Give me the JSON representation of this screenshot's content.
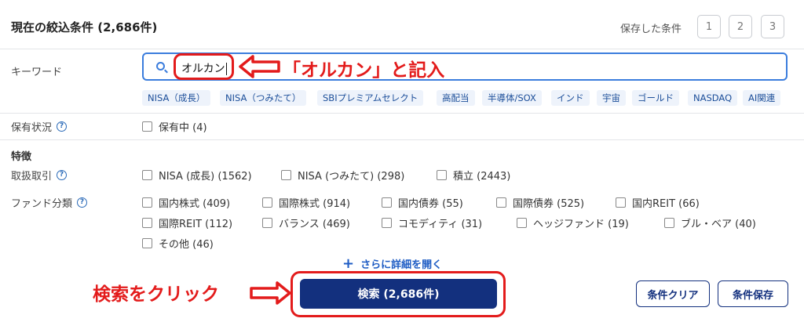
{
  "header": {
    "title": "現在の絞込条件 (2,686件)",
    "saved_label": "保存した条件",
    "slots": [
      "1",
      "2",
      "3"
    ]
  },
  "keyword": {
    "label": "キーワード",
    "value": "オルカン",
    "icon": "search-icon",
    "chips": [
      "NISA（成長）",
      "NISA（つみたて）",
      "SBIプレミアムセレクト",
      "高配当",
      "半導体/SOX",
      "インド",
      "宇宙",
      "ゴールド",
      "NASDAQ",
      "AI関連"
    ]
  },
  "holding": {
    "label": "保有状況",
    "options": [
      "保有中 (4)"
    ]
  },
  "features": {
    "section_label": "特徴",
    "handling": {
      "label": "取扱取引",
      "options": [
        "NISA (成長) (1562)",
        "NISA (つみたて) (298)",
        "積立 (2443)"
      ]
    },
    "category": {
      "label": "ファンド分類",
      "options": [
        "国内株式 (409)",
        "国際株式 (914)",
        "国内債券 (55)",
        "国際債券 (525)",
        "国内REIT (66)",
        "国際REIT (112)",
        "バランス (469)",
        "コモディティ (31)",
        "ヘッジファンド (19)",
        "ブル・ベア (40)",
        "その他 (46)"
      ]
    }
  },
  "more_link": "さらに詳細を開く",
  "buttons": {
    "search": "検索 (2,686件)",
    "clear": "条件クリア",
    "save": "条件保存"
  },
  "annotations": {
    "keyword_note": "「オルカン」と記入",
    "click_note": "検索をクリック",
    "color": "#e31b1b"
  },
  "colors": {
    "primary": "#13307e",
    "accent": "#3b7ddd",
    "chip_bg": "#eef3fb"
  }
}
